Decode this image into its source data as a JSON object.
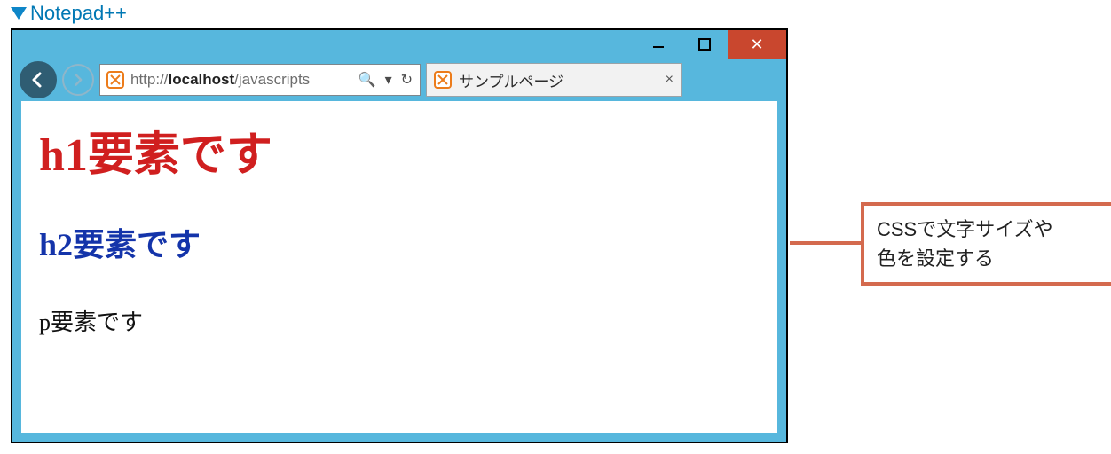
{
  "topLabel": "Notepad++",
  "window": {
    "back": "←",
    "forward": "→",
    "url_pre": "http://",
    "url_host": "localhost",
    "url_rest": "/javascripts",
    "search_icon": "🔍",
    "refresh_icon": "↻",
    "dropdown": "▾",
    "tab_title": "サンプルページ",
    "tab_close": "×",
    "min": "—",
    "max": "▢",
    "close": "✕"
  },
  "page": {
    "h1": "h1要素です",
    "h2": "h2要素です",
    "p": "p要素です"
  },
  "callout": {
    "line1": "CSSで文字サイズや",
    "line2": "色を設定する"
  }
}
